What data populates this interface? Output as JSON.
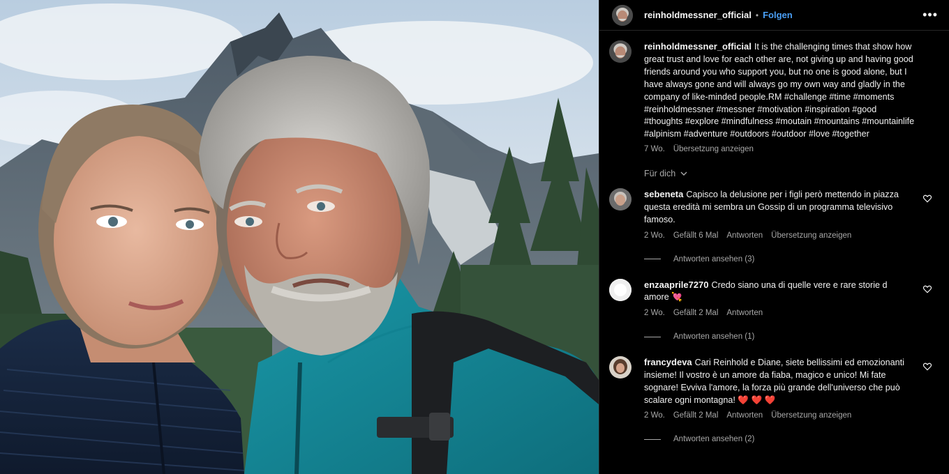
{
  "post": {
    "username": "reinholdmessner_official",
    "separator": "•",
    "follow_label": "Folgen",
    "more_label": "•••",
    "caption": "It is the challenging times that show how great trust and love for each other are, not giving up and having good friends around you who support you, but no one is good alone, but I have always gone and will always go my own way and gladly in the company of like-minded people.RM #challenge #time #moments #reinholdmessner #messner #motivation #inspiration #good #thoughts #explore #mindfulness #moutain #mountains #mountainlife #alpinism #adventure #outdoors #outdoor #love #together",
    "caption_age": "7 Wo.",
    "caption_translate": "Übersetzung anzeigen"
  },
  "sort_label": "Für dich",
  "comments": [
    {
      "username": "sebeneta",
      "text": "Capisco la delusione per i figli però mettendo in piazza questa eredità mi sembra un Gossip di un programma televisivo famoso.",
      "age": "2 Wo.",
      "likes": "Gefällt 6 Mal",
      "reply": "Antworten",
      "translate": "Übersetzung anzeigen",
      "view_replies": "Antworten ansehen (3)"
    },
    {
      "username": "enzaaprile7270",
      "text": "Credo siano una di quelle vere e rare storie d amore 💘",
      "age": "2 Wo.",
      "likes": "Gefällt 2 Mal",
      "reply": "Antworten",
      "translate": "",
      "view_replies": "Antworten ansehen (1)"
    },
    {
      "username": "francydeva",
      "text": "Cari Reinhold e Diane, siete bellissimi ed emozionanti insieme! Il vostro è un amore da fiaba, magico e unico! Mi fate sognare! Evviva l'amore, la forza più grande dell'universo che può scalare ogni montagna! ❤️ ❤️ ❤️",
      "age": "2 Wo.",
      "likes": "Gefällt 2 Mal",
      "reply": "Antworten",
      "translate": "Übersetzung anzeigen",
      "view_replies": "Antworten ansehen (2)"
    }
  ],
  "colors": {
    "link_blue": "#4a9ff5",
    "muted_text": "#a8a8a8",
    "background": "#000000"
  }
}
